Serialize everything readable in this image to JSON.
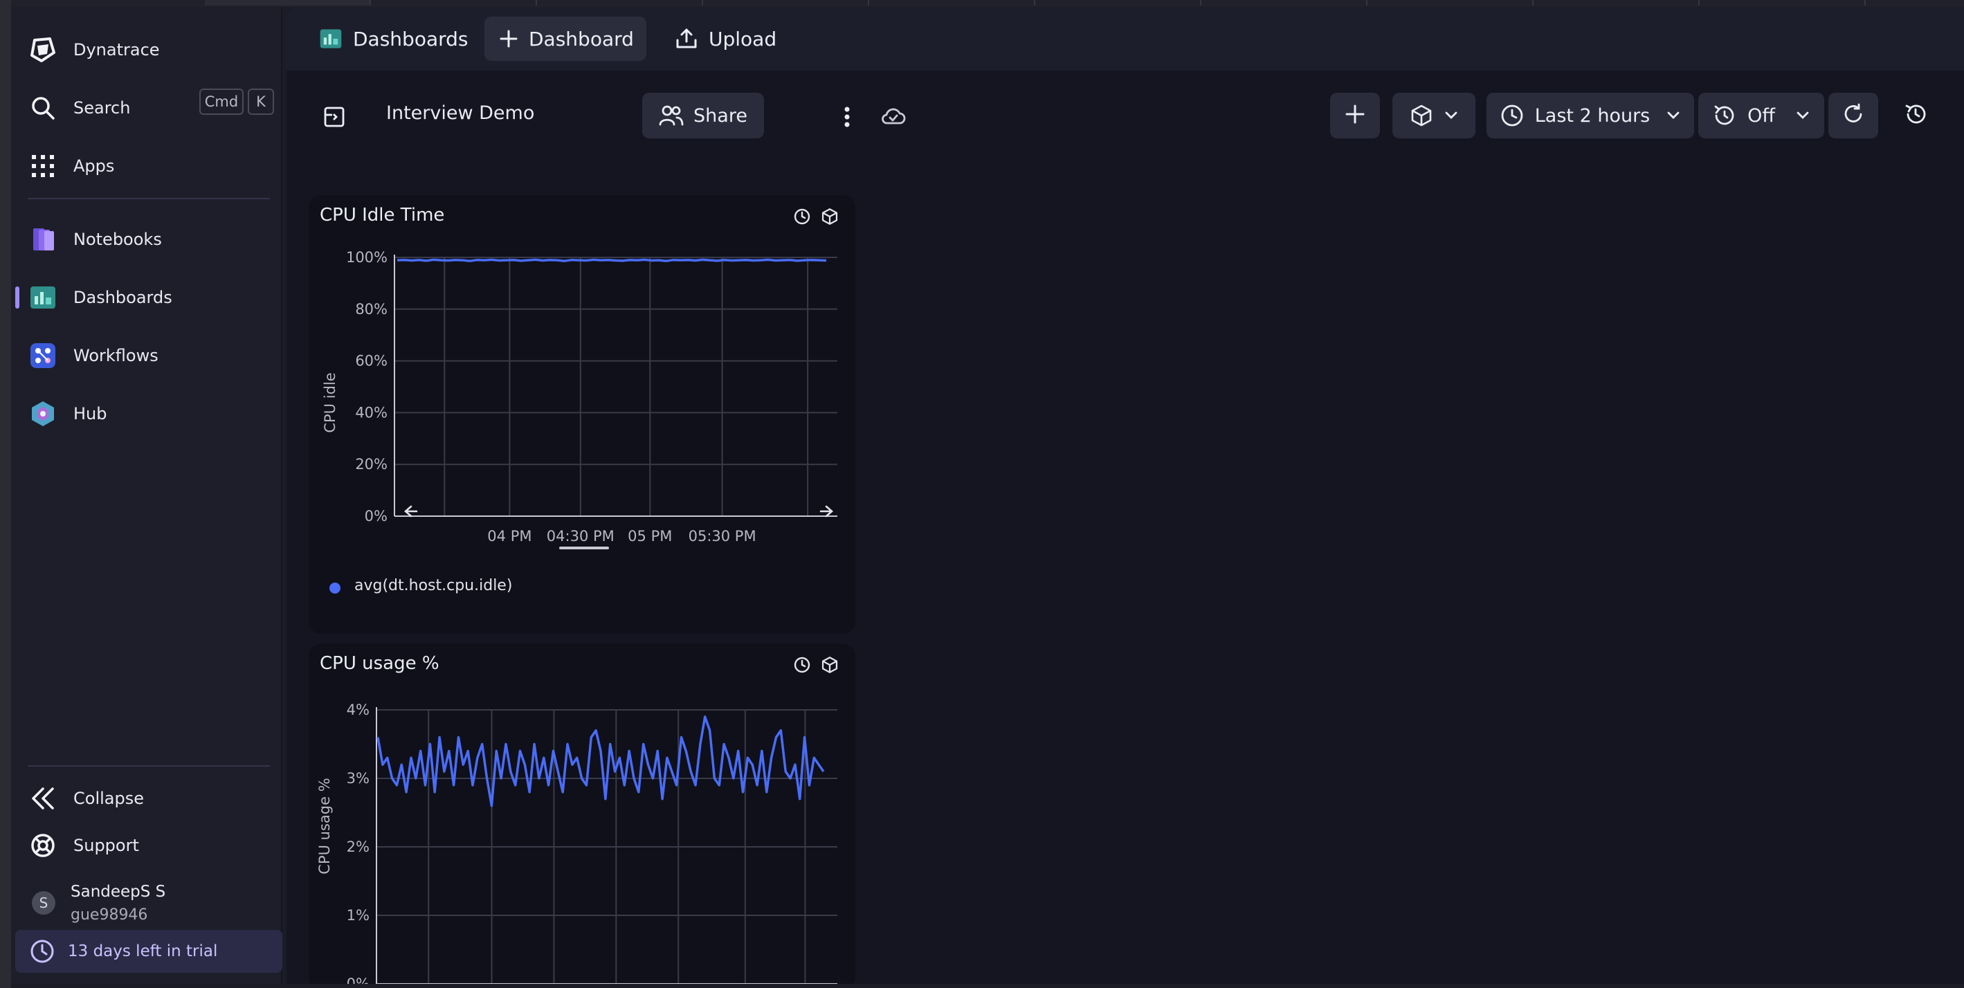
{
  "sidebar": {
    "brand": "Dynatrace",
    "search": {
      "label": "Search",
      "shortcut": [
        "Cmd",
        "K"
      ]
    },
    "apps_label": "Apps",
    "items": [
      {
        "label": "Notebooks"
      },
      {
        "label": "Dashboards"
      },
      {
        "label": "Workflows"
      },
      {
        "label": "Hub"
      }
    ],
    "bottom": {
      "collapse": "Collapse",
      "support": "Support",
      "user_initial": "S",
      "user_name": "SandeepS S",
      "user_id": "gue98946",
      "trial": "13 days left in trial"
    }
  },
  "tabs": [
    {
      "label": "Dashboards"
    },
    {
      "label": "Dashboard"
    },
    {
      "label": "Upload"
    }
  ],
  "toolbar": {
    "dashboard_name": "Interview Demo",
    "share_label": "Share",
    "timeframe": "Last 2 hours",
    "refresh": "Off"
  },
  "colors": {
    "accent": "#9b8cff",
    "series": "#4a6cf7",
    "tile_bg": "#0f1019"
  },
  "chart_data": [
    {
      "type": "line",
      "title": "CPU Idle Time",
      "ylabel": "CPU idle",
      "xlabel": "",
      "ylim": [
        0,
        100
      ],
      "yticks": [
        "0%",
        "20%",
        "40%",
        "60%",
        "80%",
        "100%"
      ],
      "xticks": [
        "04 PM",
        "04:30 PM",
        "05 PM",
        "05:30 PM"
      ],
      "grid": true,
      "legend": "bottom-left",
      "series": [
        {
          "name": "avg(dt.host.cpu.idle)",
          "values": [
            98.9,
            99.0,
            98.8,
            99.0,
            98.7,
            99.1,
            98.9,
            98.8,
            99.0,
            98.9,
            98.6,
            99.0,
            98.9,
            99.1,
            98.8,
            98.9,
            99.0,
            98.7,
            98.9,
            99.1,
            98.8,
            99.0,
            98.9,
            98.6,
            99.0,
            98.9,
            98.8,
            99.1,
            98.9,
            99.0,
            98.8,
            98.7,
            99.0,
            98.9,
            99.1,
            98.8,
            98.9,
            98.6,
            99.0,
            98.9,
            99.0,
            98.8,
            99.1,
            98.9,
            98.7,
            99.0,
            98.8,
            98.9,
            99.0,
            98.8,
            98.9,
            99.1,
            98.8,
            98.9,
            99.0,
            98.7,
            98.9,
            99.0,
            98.9,
            98.8
          ]
        }
      ]
    },
    {
      "type": "line",
      "title": "CPU usage %",
      "ylabel": "CPU usage %",
      "xlabel": "",
      "ylim": [
        0,
        4
      ],
      "yticks": [
        "0%",
        "1%",
        "2%",
        "3%",
        "4%"
      ],
      "grid": true,
      "series": [
        {
          "name": "CPU usage",
          "values": [
            3.6,
            3.2,
            3.3,
            3.0,
            2.9,
            3.2,
            2.8,
            3.3,
            3.0,
            3.4,
            2.9,
            3.5,
            2.8,
            3.6,
            3.1,
            3.4,
            2.9,
            3.6,
            3.2,
            3.4,
            2.9,
            3.3,
            3.5,
            3.0,
            2.6,
            3.4,
            3.0,
            3.5,
            3.1,
            2.9,
            3.4,
            3.2,
            2.8,
            3.5,
            3.0,
            3.3,
            2.9,
            3.4,
            3.1,
            2.8,
            3.5,
            3.2,
            3.3,
            3.0,
            2.9,
            3.6,
            3.7,
            3.4,
            2.7,
            3.5,
            3.1,
            3.3,
            2.9,
            3.4,
            3.0,
            2.8,
            3.5,
            3.2,
            3.0,
            3.4,
            2.7,
            3.3,
            3.1,
            2.9,
            3.6,
            3.4,
            3.1,
            2.9,
            3.5,
            3.9,
            3.7,
            3.0,
            2.9,
            3.5,
            3.3,
            3.0,
            3.4,
            2.8,
            3.3,
            3.2,
            2.9,
            3.4,
            2.8,
            3.3,
            3.6,
            3.7,
            3.1,
            3.0,
            3.2,
            2.7,
            3.6,
            2.9,
            3.3,
            3.2,
            3.1
          ]
        }
      ]
    }
  ]
}
